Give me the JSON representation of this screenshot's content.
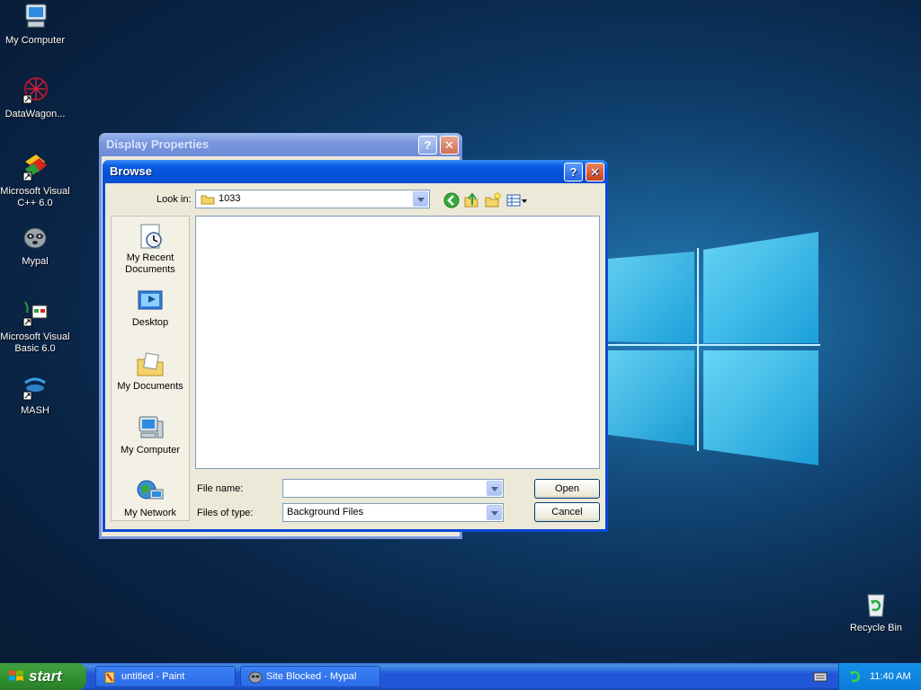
{
  "desktop": {
    "icons": [
      {
        "label": "My Computer"
      },
      {
        "label": "DataWagon..."
      },
      {
        "label": "Microsoft Visual C++ 6.0"
      },
      {
        "label": "Mypal"
      },
      {
        "label": "Microsoft Visual Basic 6.0"
      },
      {
        "label": "MASH"
      },
      {
        "label": "Recycle Bin"
      }
    ]
  },
  "display_properties": {
    "title": "Display Properties",
    "help_label": "?",
    "close_label": "✕"
  },
  "browse": {
    "title": "Browse",
    "help_label": "?",
    "close_label": "✕",
    "look_in_label": "Look in:",
    "look_in_value": "1033",
    "places": [
      {
        "label": "My Recent Documents"
      },
      {
        "label": "Desktop"
      },
      {
        "label": "My Documents"
      },
      {
        "label": "My Computer"
      },
      {
        "label": "My Network"
      }
    ],
    "file_name_label": "File name:",
    "file_name_value": "",
    "files_of_type_label": "Files of type:",
    "files_of_type_value": "Background Files",
    "open_label": "Open",
    "cancel_label": "Cancel"
  },
  "taskbar": {
    "start_label": "start",
    "tasks": [
      {
        "label": "untitled - Paint"
      },
      {
        "label": "Site Blocked - Mypal"
      }
    ],
    "clock": "11:40 AM"
  },
  "colors": {
    "title_active": "#0a5ee2",
    "taskbar": "#2157d7",
    "start": "#3c9a3a"
  }
}
